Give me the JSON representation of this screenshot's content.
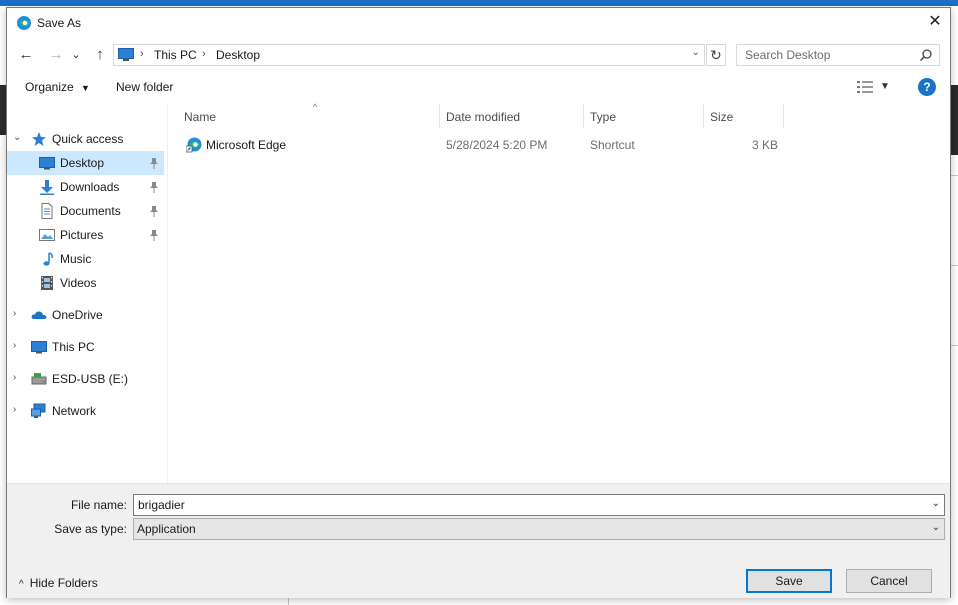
{
  "window": {
    "title": "Save As",
    "close": "✕"
  },
  "nav": {
    "back": "←",
    "forward": "→",
    "recent": "⌄",
    "up": "↑",
    "refresh": "↻"
  },
  "address": {
    "crumbs": [
      "This PC",
      "Desktop"
    ],
    "separator": "›",
    "dropdown": "⌄"
  },
  "search": {
    "placeholder": "Search Desktop"
  },
  "toolbar": {
    "organize": "Organize",
    "new_folder": "New folder",
    "help": "?"
  },
  "sidebar": {
    "quick_access": "Quick access",
    "items": [
      {
        "label": "Desktop",
        "pinned": true,
        "selected": true
      },
      {
        "label": "Downloads",
        "pinned": true
      },
      {
        "label": "Documents",
        "pinned": true
      },
      {
        "label": "Pictures",
        "pinned": true
      },
      {
        "label": "Music"
      },
      {
        "label": "Videos"
      }
    ],
    "roots": [
      "OneDrive",
      "This PC",
      "ESD-USB (E:)",
      "Network"
    ]
  },
  "columns": {
    "name": "Name",
    "date": "Date modified",
    "type": "Type",
    "size": "Size"
  },
  "files": [
    {
      "name": "Microsoft Edge",
      "date": "5/28/2024 5:20 PM",
      "type": "Shortcut",
      "size": "3 KB"
    }
  ],
  "form": {
    "file_name_label": "File name:",
    "file_name_value": "brigadier",
    "save_type_label": "Save as type:",
    "save_type_value": "Application",
    "hide_folders": "Hide Folders",
    "save": "Save",
    "cancel": "Cancel"
  },
  "colors": {
    "accent": "#0078d7",
    "selection": "#cce8ff",
    "folder_blue": "#1a73c8"
  }
}
